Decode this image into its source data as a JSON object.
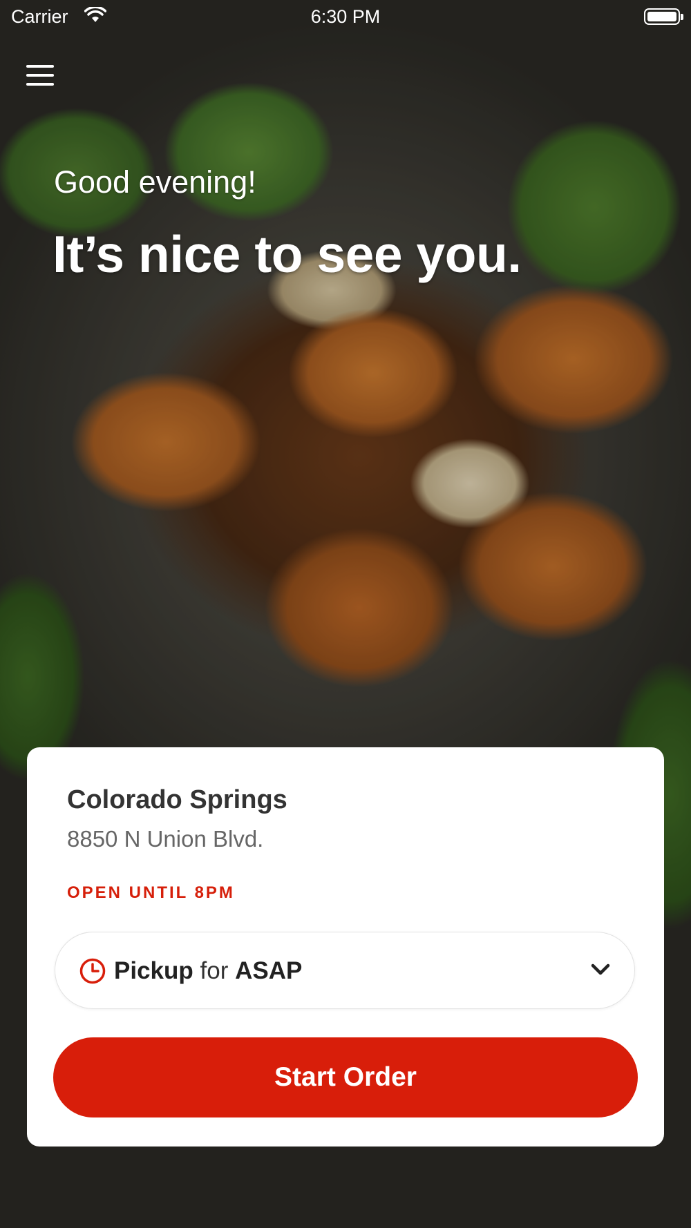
{
  "status_bar": {
    "carrier": "Carrier",
    "time": "6:30 PM",
    "wifi_icon": "wifi-icon",
    "battery_icon": "battery-icon"
  },
  "header": {
    "menu_icon": "hamburger-menu-icon"
  },
  "hero": {
    "greeting": "Good evening!",
    "headline": "It’s nice to see you."
  },
  "location_card": {
    "name": "Colorado Springs",
    "address": "8850 N Union Blvd.",
    "hours_status": "OPEN UNTIL 8PM",
    "order_picker": {
      "icon": "clock-icon",
      "mode": "Pickup",
      "connector": "for",
      "time": "ASAP",
      "chevron_icon": "chevron-down-icon"
    },
    "start_button_label": "Start Order"
  },
  "colors": {
    "accent": "#d81e0a",
    "hours_text": "#d61f0a",
    "card_background": "#ffffff"
  }
}
